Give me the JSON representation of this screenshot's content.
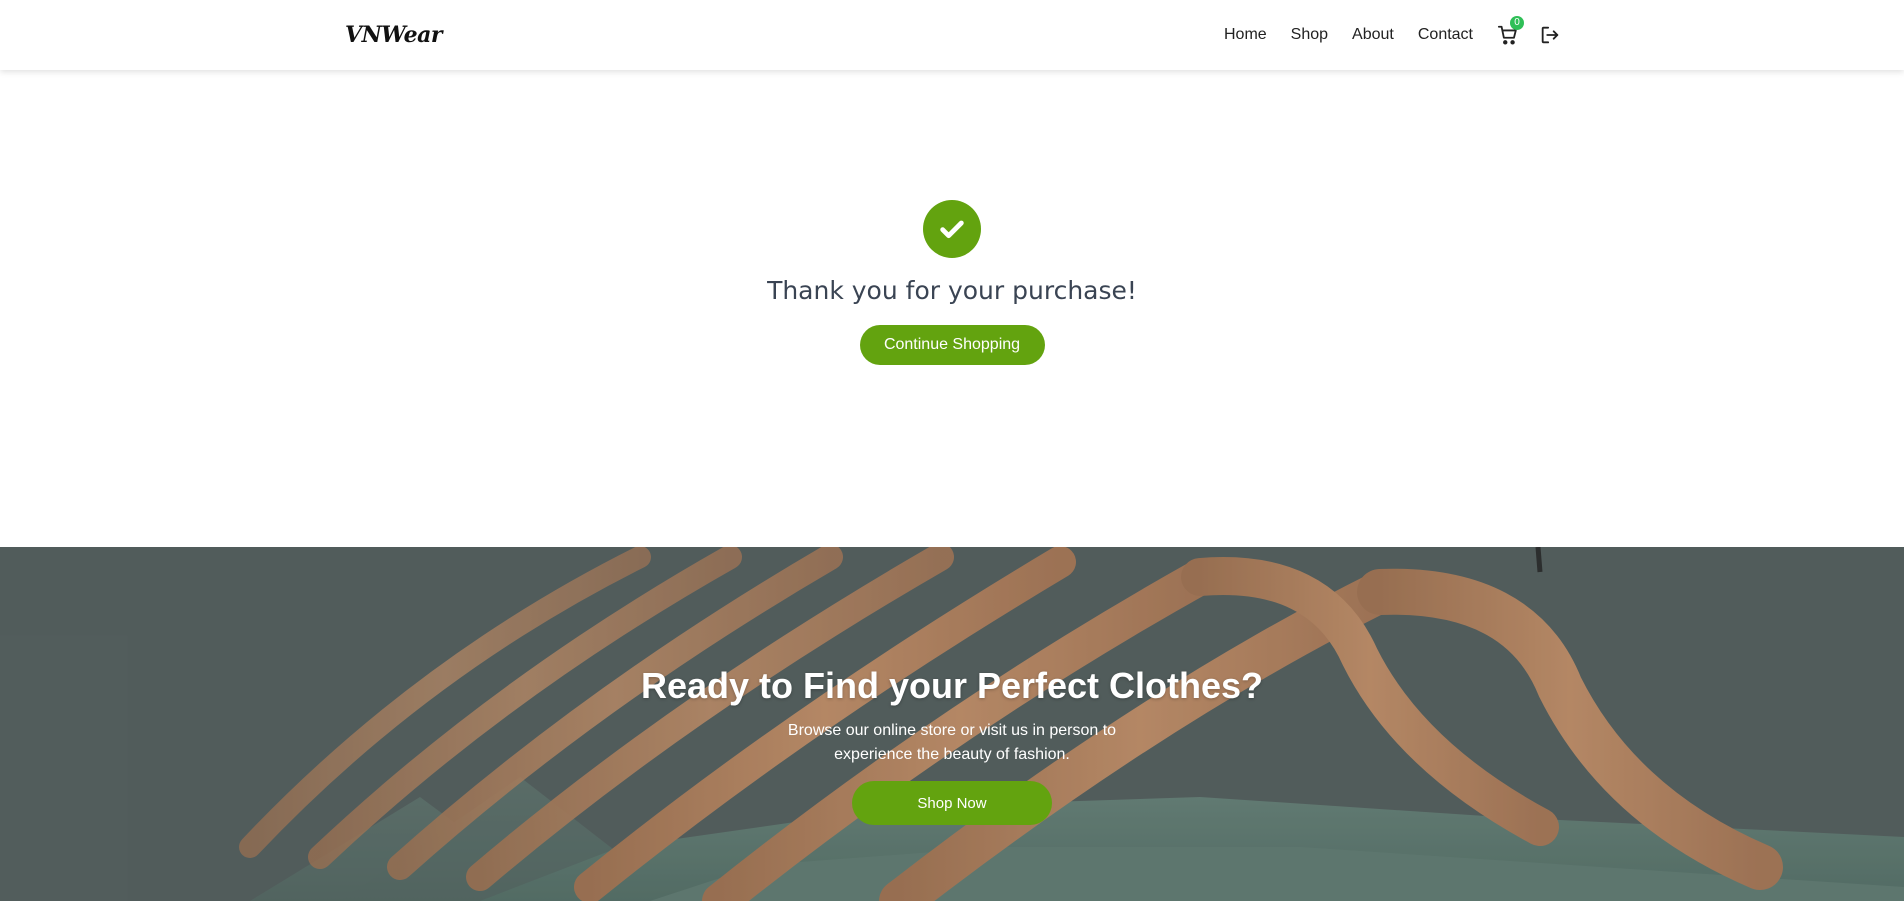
{
  "header": {
    "logo": "VNWear",
    "nav": [
      "Home",
      "Shop",
      "About",
      "Contact"
    ],
    "cart_count": "0",
    "cart_icon": "cart-icon",
    "logout_icon": "logout-icon"
  },
  "confirmation": {
    "icon": "check-icon",
    "message": "Thank you for your purchase!",
    "button_label": "Continue Shopping"
  },
  "hero": {
    "title": "Ready to Find your Perfect Clothes?",
    "subtitle": "Browse our online store or visit us in person to experience the beauty of fashion.",
    "button_label": "Shop Now"
  },
  "colors": {
    "accent": "#63a30f",
    "badge": "#2fbf57",
    "text_dark": "#3a4453"
  }
}
